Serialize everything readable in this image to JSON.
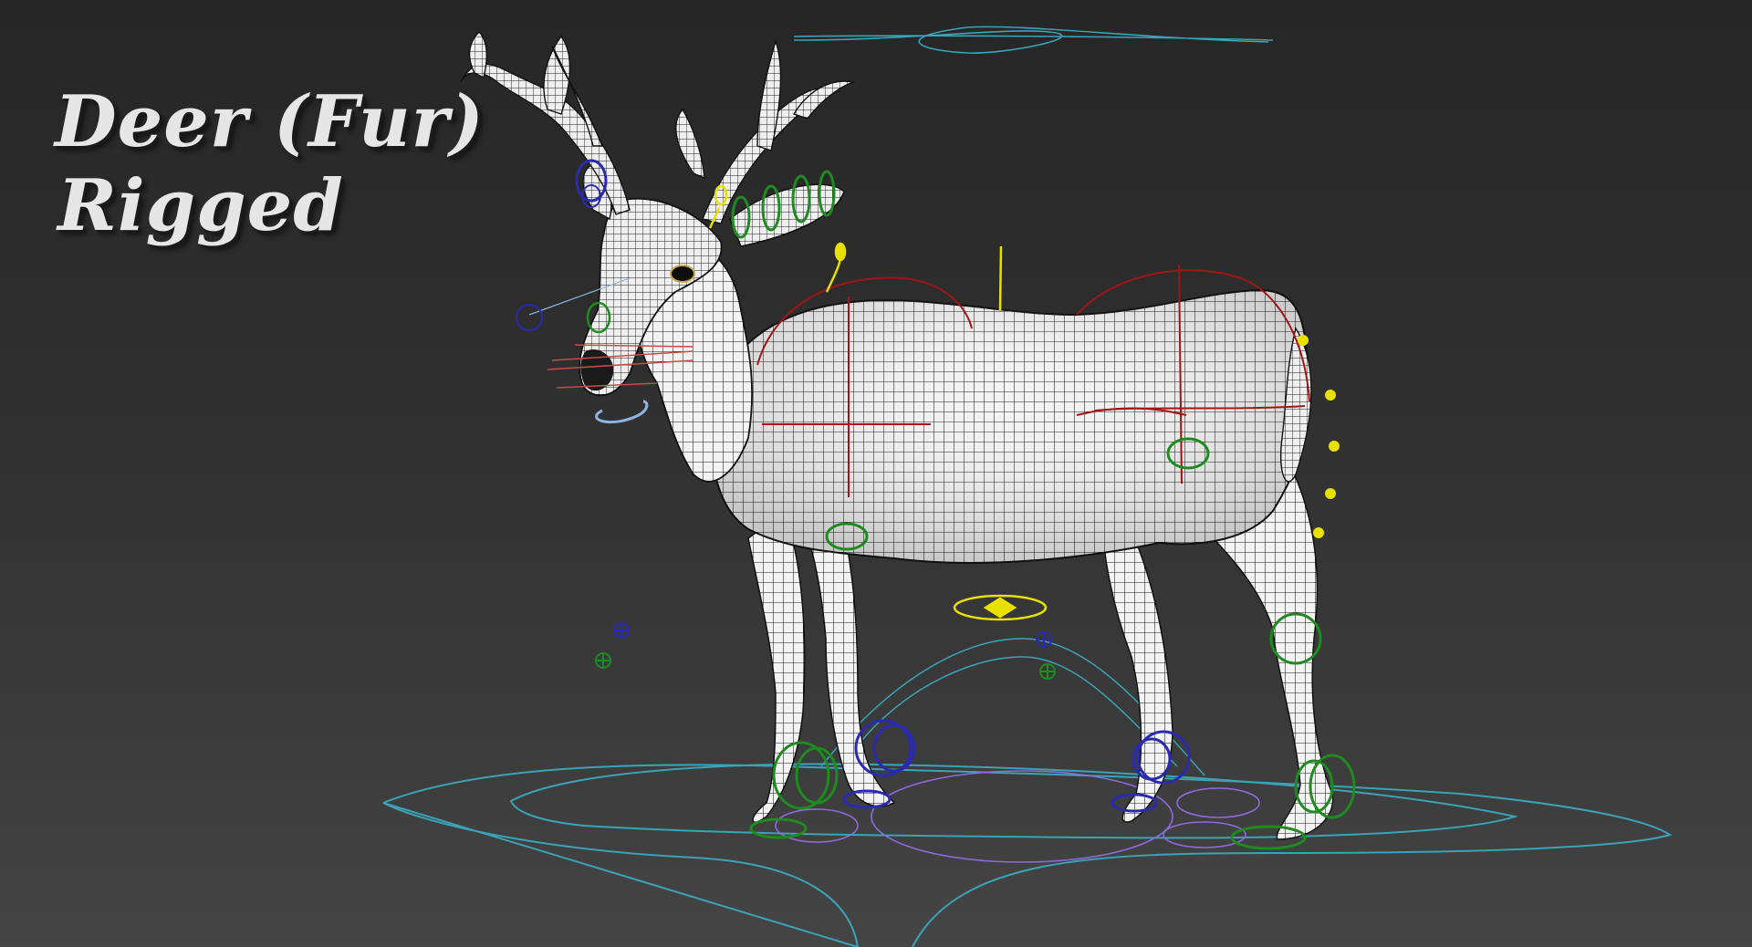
{
  "overlay": {
    "title_line1": "Deer (Fur)",
    "title_line2": "Rigged"
  },
  "viewport": {
    "background_top": "#262626",
    "background_bottom": "#454545"
  },
  "model": {
    "mesh_color": "#f2f2f2",
    "wire_color": "#1a1a1a"
  },
  "rig_colors": {
    "master": "#3aa3b8",
    "cog": "#e8e000",
    "spine": "#a01515",
    "leg_left": "#1f8a1f",
    "leg_right": "#2a2ab0",
    "foot_pad": "#8e6adf",
    "jaw": "#8fb4e0"
  }
}
